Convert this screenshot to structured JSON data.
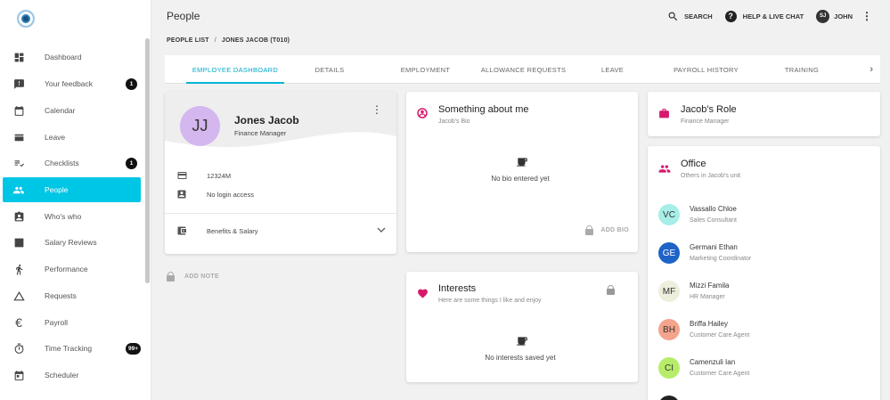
{
  "sidebar": {
    "items": [
      {
        "label": "Dashboard",
        "icon": "dashboard-icon"
      },
      {
        "label": "Your feedback",
        "icon": "feedback-icon",
        "badge": "1"
      },
      {
        "label": "Calendar",
        "icon": "calendar-icon"
      },
      {
        "label": "Leave",
        "icon": "leave-icon"
      },
      {
        "label": "Checklists",
        "icon": "checklist-icon",
        "badge": "1"
      },
      {
        "label": "People",
        "icon": "people-icon",
        "active": true
      },
      {
        "label": "Who's who",
        "icon": "contact-card-icon"
      },
      {
        "label": "Salary Reviews",
        "icon": "chart-icon"
      },
      {
        "label": "Performance",
        "icon": "runner-icon"
      },
      {
        "label": "Requests",
        "icon": "triangle-icon"
      },
      {
        "label": "Payroll",
        "icon": "euro-icon"
      },
      {
        "label": "Time Tracking",
        "icon": "stopwatch-icon",
        "badge": "99+"
      },
      {
        "label": "Scheduler",
        "icon": "scheduler-icon"
      }
    ]
  },
  "header": {
    "title": "People",
    "search_label": "SEARCH",
    "help_label": "HELP & LIVE CHAT",
    "user_initials": "SJ",
    "user_name": "JOHN"
  },
  "breadcrumb": {
    "root": "PEOPLE LIST",
    "separator": "/",
    "current": "JONES JACOB (T010)"
  },
  "tabs": [
    {
      "label": "EMPLOYEE DASHBOARD",
      "active": true
    },
    {
      "label": "DETAILS"
    },
    {
      "label": "EMPLOYMENT"
    },
    {
      "label": "ALLOWANCE REQUESTS"
    },
    {
      "label": "LEAVE"
    },
    {
      "label": "PAYROLL HISTORY"
    },
    {
      "label": "TRAINING"
    }
  ],
  "profile": {
    "initials": "JJ",
    "name": "Jones Jacob",
    "role": "Finance Manager",
    "employee_code": "12324M",
    "login_access": "No login access",
    "benefits_label": "Benefits & Salary",
    "add_note_label": "ADD NOTE",
    "avatar_color": "#d4b7ee"
  },
  "bio_card": {
    "title": "Something about me",
    "subtitle": "Jacob's Bio",
    "empty_text": "No bio entered yet",
    "add_label": "ADD BIO"
  },
  "interests_card": {
    "title": "Interests",
    "subtitle": "Here are some things I like and enjoy",
    "empty_text": "No interests saved yet"
  },
  "role_card": {
    "title": "Jacob's Role",
    "subtitle": "Finance Manager"
  },
  "office_card": {
    "title": "Office",
    "subtitle": "Others in Jacob's unit",
    "people": [
      {
        "initials": "VC",
        "name": "Vassallo Chloe",
        "title": "Sales Consultant",
        "color": "#a8eee8"
      },
      {
        "initials": "GE",
        "name": "Germani Ethan",
        "title": "Marketing Coordinator",
        "color": "#1e63c6",
        "text_color": "#ffffff"
      },
      {
        "initials": "MF",
        "name": "Mizzi Famila",
        "title": "HR Manager",
        "color": "#eeeedd"
      },
      {
        "initials": "BH",
        "name": "Briffa Hailey",
        "title": "Customer Care Agent",
        "color": "#f4a48c"
      },
      {
        "initials": "CI",
        "name": "Camenzuli Ian",
        "title": "Customer Care Agent",
        "color": "#b7ec6a"
      }
    ]
  },
  "colors": {
    "accent": "#00c6e6",
    "tab_active": "#00a9c9",
    "role_icon": "#d6196b",
    "heart_icon": "#d6196b"
  }
}
